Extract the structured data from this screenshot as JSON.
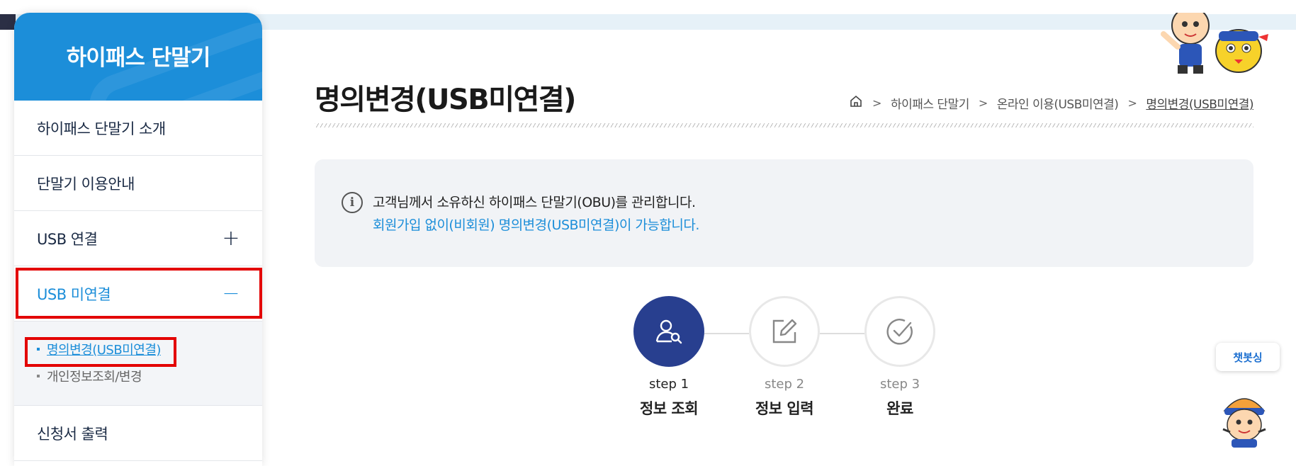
{
  "sidebar": {
    "title": "하이패스 단말기",
    "items": [
      {
        "label": "하이패스 단말기 소개"
      },
      {
        "label": "단말기 이용안내"
      },
      {
        "label": "USB 연결",
        "toggle": "+"
      },
      {
        "label": "USB 미연결",
        "toggle": "−"
      }
    ],
    "submenu": [
      {
        "label": "명의변경(USB미연결)"
      },
      {
        "label": "개인정보조회/변경"
      }
    ],
    "last_item": "신청서 출력"
  },
  "page": {
    "title": "명의변경(USB미연결)",
    "breadcrumb": [
      "하이패스 단말기",
      "온라인 이용(USB미연결)",
      "명의변경(USB미연결)"
    ]
  },
  "notice": {
    "line1": "고객님께서 소유하신 하이패스 단말기(OBU)를 관리합니다.",
    "line2": "회원가입 없이(비회원) 명의변경(USB미연결)이 가능합니다."
  },
  "steps": [
    {
      "num": "step 1",
      "name": "정보 조회",
      "icon": "user-search-icon"
    },
    {
      "num": "step 2",
      "name": "정보 입력",
      "icon": "edit-icon"
    },
    {
      "num": "step 3",
      "name": "완료",
      "icon": "check-circle-icon"
    }
  ],
  "chatbot": {
    "label": "챗봇싱"
  },
  "colors": {
    "primary": "#1c8ed9",
    "step_active": "#283f8f",
    "highlight": "#e30000"
  }
}
